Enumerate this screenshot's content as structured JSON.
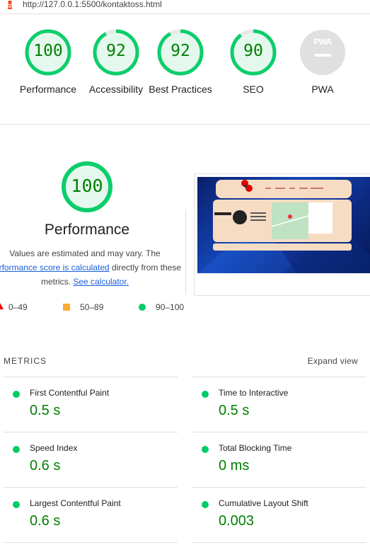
{
  "browser": {
    "url": "http://127.0.0.1:5500/kontaktoss.html"
  },
  "colors": {
    "pass": "#0cce6b",
    "pass_text": "#008000",
    "average": "#ffaa33",
    "fail": "#ff3333",
    "na": "#c0c0c0"
  },
  "categories": [
    {
      "score": "100",
      "label": "Performance",
      "value": 100,
      "color": "#0cce6b"
    },
    {
      "score": "92",
      "label": "Accessibility",
      "value": 92,
      "color": "#0cce6b"
    },
    {
      "score": "92",
      "label": "Best Practices",
      "value": 92,
      "color": "#0cce6b"
    },
    {
      "score": "90",
      "label": "SEO",
      "value": 90,
      "color": "#0cce6b"
    },
    {
      "score": "PWA",
      "label": "PWA",
      "value": null,
      "color": "#c0c0c0"
    }
  ],
  "performance": {
    "score": "100",
    "title": "Performance",
    "desc_text_1": "Values are estimated and may vary. The",
    "desc_link_1": "Performance score is calculated",
    "desc_text_2": "directly from these metrics.",
    "desc_link_2": "See calculator."
  },
  "legend": {
    "fail": "0–49",
    "average": "50–89",
    "pass": "90–100"
  },
  "metrics": {
    "title": "METRICS",
    "expand_label": "Expand view",
    "items": [
      {
        "label": "First Contentful Paint",
        "value": "0.5 s"
      },
      {
        "label": "Time to Interactive",
        "value": "0.5 s"
      },
      {
        "label": "Speed Index",
        "value": "0.6 s"
      },
      {
        "label": "Total Blocking Time",
        "value": "0 ms"
      },
      {
        "label": "Largest Contentful Paint",
        "value": "0.6 s"
      },
      {
        "label": "Cumulative Layout Shift",
        "value": "0.003"
      }
    ]
  }
}
